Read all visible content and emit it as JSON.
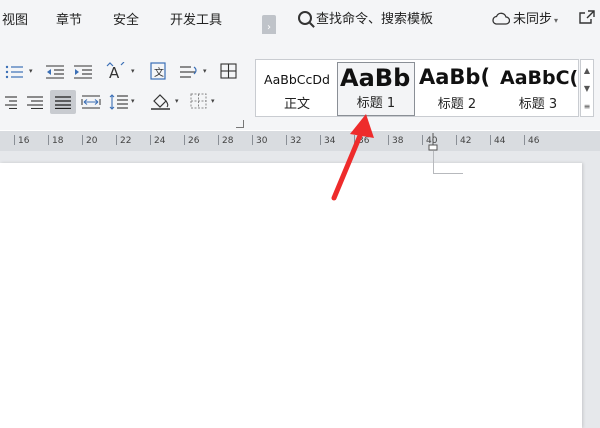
{
  "menubar": {
    "items": [
      "视图",
      "章节",
      "安全",
      "开发工具"
    ],
    "more_glyph": "›",
    "search_label": "查找命令、搜索模板",
    "sync_label": "未同步",
    "sync_caret": "▾"
  },
  "ribbon": {
    "dropdown_caret": "▾"
  },
  "styles": {
    "items": [
      {
        "sample": "AaBbCcDd",
        "name": "正文"
      },
      {
        "sample": "AaBb",
        "name": "标题 1"
      },
      {
        "sample": "AaBb(",
        "name": "标题 2"
      },
      {
        "sample": "AaBbC(",
        "name": "标题 3"
      }
    ],
    "selected_index": 1,
    "scroll_up": "▲",
    "scroll_down": "▼",
    "scroll_more": "≡"
  },
  "ruler": {
    "labels": [
      "16",
      "18",
      "20",
      "22",
      "24",
      "26",
      "28",
      "30",
      "32",
      "34",
      "36",
      "38",
      "40",
      "42",
      "44",
      "46"
    ]
  },
  "colors": {
    "annotation_arrow": "#ee2b2b",
    "accent": "#5b8ff9"
  }
}
